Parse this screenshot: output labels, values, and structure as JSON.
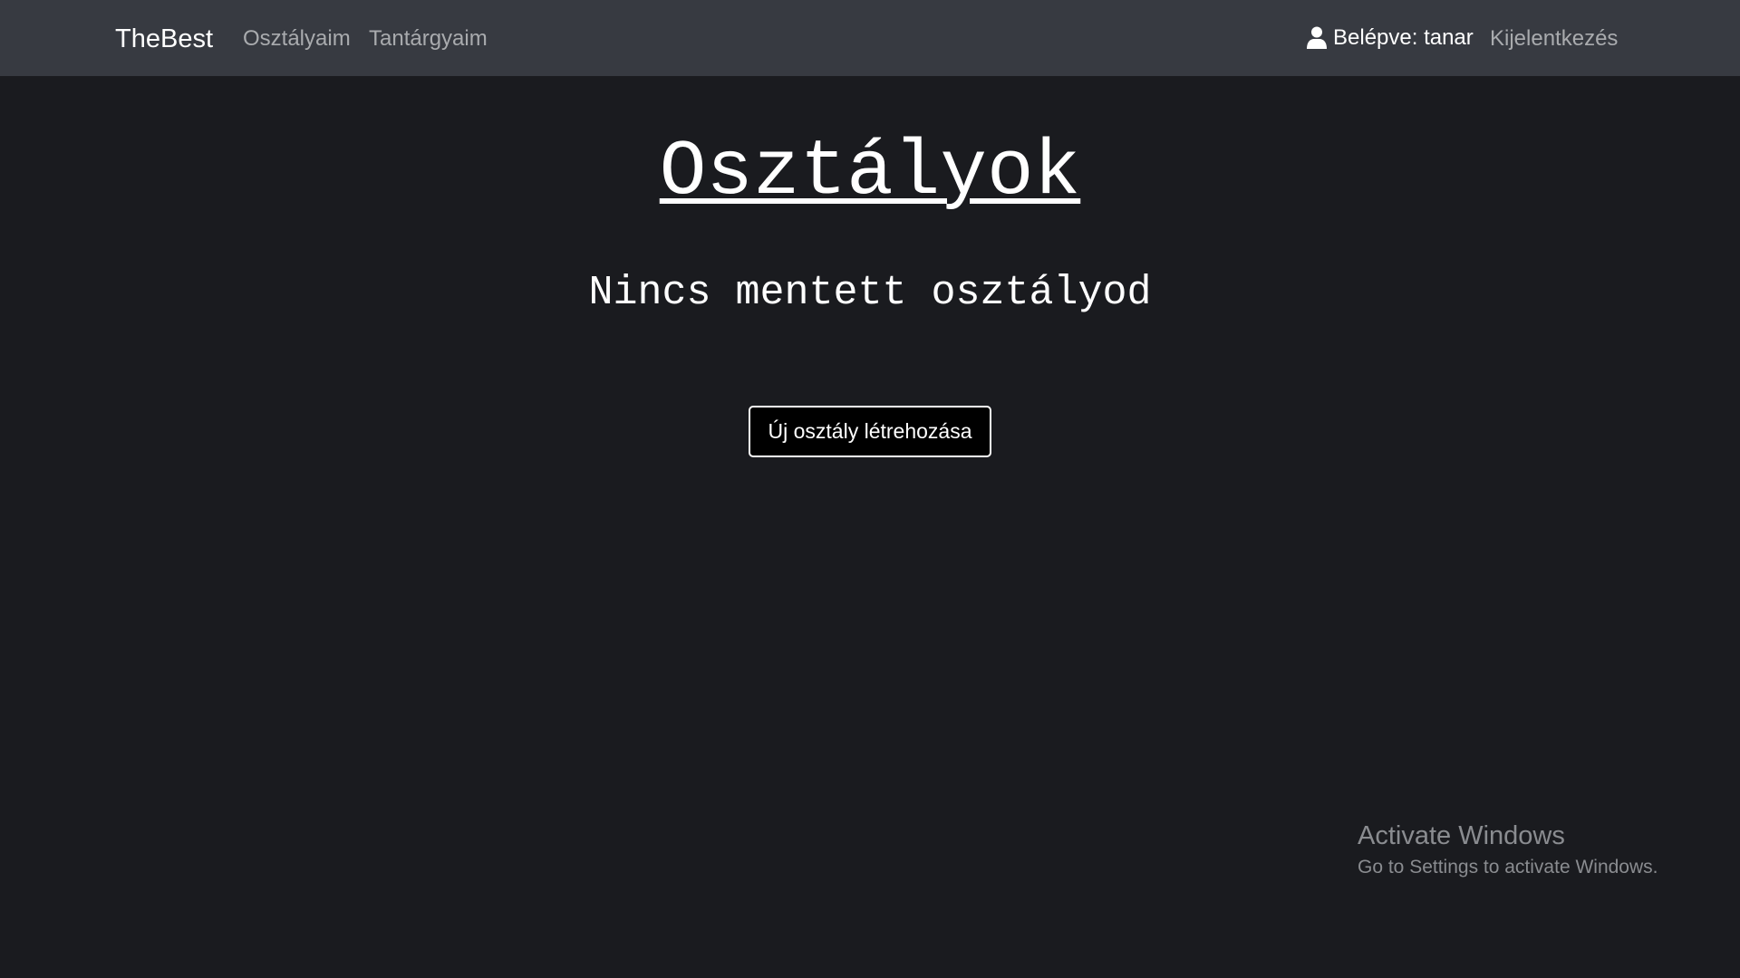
{
  "navbar": {
    "brand": "TheBest",
    "links": [
      {
        "label": "Osztályaim"
      },
      {
        "label": "Tantárgyaim"
      }
    ],
    "user": {
      "icon": "user-icon",
      "label": "Belépve: tanar"
    },
    "logout_label": "Kijelentkezés"
  },
  "main": {
    "title": "Osztályok",
    "empty_message": "Nincs mentett osztályod",
    "create_button_label": "Új osztály létrehozása"
  },
  "watermark": {
    "title": "Activate Windows",
    "subtitle": "Go to Settings to activate Windows."
  },
  "colors": {
    "navbar_bg": "#373a41",
    "page_bg": "#1a1b1f",
    "nav_link": "#a9abae",
    "text": "#ffffff"
  }
}
